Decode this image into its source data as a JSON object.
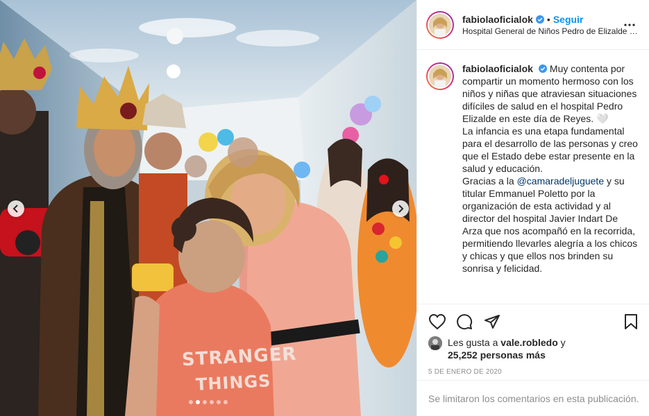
{
  "post": {
    "username": "fabiolaoficialok",
    "follow_label": "Seguir",
    "separator": "•",
    "location": "Hospital General de Niños Pedro de Elizalde e...",
    "shirt_line1": "STRANGER",
    "shirt_line2": "THINGS",
    "caption": {
      "username": "fabiolaoficialok",
      "line_a": "Muy contenta por compartir un momento hermoso con los niños y niñas que atraviesan situaciones difíciles de salud en el hospital Pedro Elizalde en este día de Reyes. 🤍",
      "line_b": "La infancia es una etapa fundamental para el desarrollo de las personas y creo que el Estado debe estar presente en la salud y educación.",
      "line_c_start": "Gracias a la",
      "mention": "@camaradeljuguete",
      "line_c_end": "y su titular Emmanuel Poletto por la organización de esta actividad y al director del hospital Javier Indart De Arza que nos acompañó en la recorrida, permitiendo llevarles alegría a los chicos y chicas y que ellos nos brinden su sonrisa y felicidad."
    },
    "likes": {
      "prefix": "Les gusta a",
      "liker": "vale.robledo",
      "joiner": "y",
      "count": "25,252 personas más"
    },
    "date": "5 DE ENERO DE 2020",
    "comments_disabled": "Se limitaron los comentarios en esta publicación.",
    "carousel": {
      "slides": 6,
      "current": 2
    }
  },
  "icons": {
    "verified": "verified-badge-icon",
    "more": "more-options-icon",
    "like": "heart-icon",
    "comment": "comment-icon",
    "share": "share-icon",
    "save": "bookmark-icon",
    "prev": "chevron-left-icon",
    "next": "chevron-right-icon"
  },
  "colors": {
    "accent": "#0095f6",
    "mention": "#00376b",
    "muted": "#8e8e8e",
    "border": "#efefef"
  }
}
